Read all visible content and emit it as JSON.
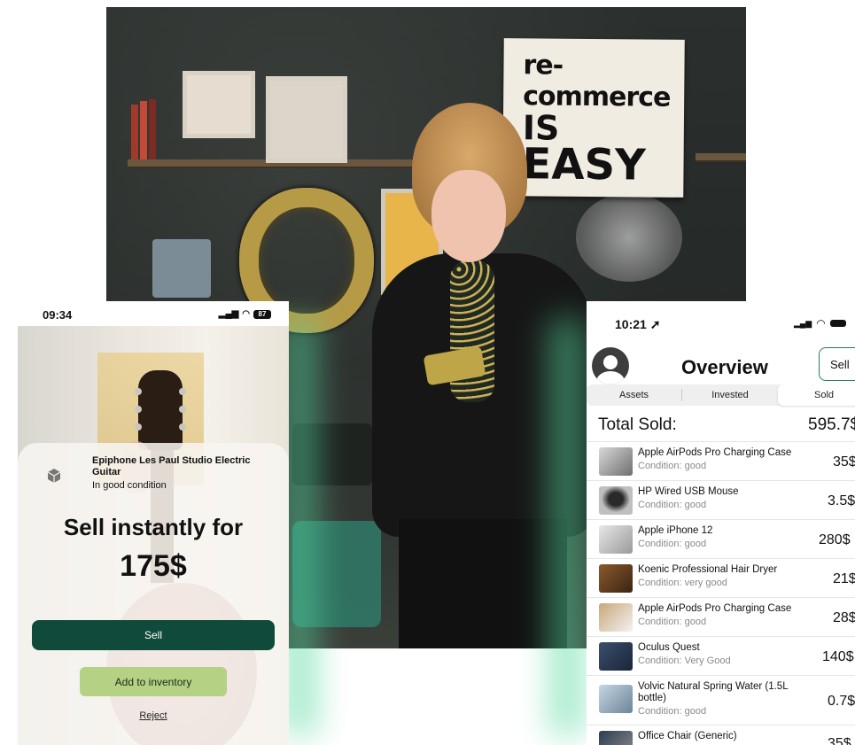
{
  "photo": {
    "sign_lines": [
      "re-commerce",
      "IS",
      "EASY"
    ]
  },
  "left_phone": {
    "status_time": "09:34",
    "battery": "87",
    "product_name": "Epiphone Les Paul Studio Electric Guitar",
    "product_condition": "In good condition",
    "headline": "Sell instantly for",
    "price": "175$",
    "sell_label": "Sell",
    "add_label": "Add to inventory",
    "reject_label": "Reject",
    "colors": {
      "sell_bg": "#0f4a3a",
      "add_bg": "#b5d184"
    }
  },
  "right_phone": {
    "status_time": "10:21",
    "title": "Overview",
    "sell_button": "Sell",
    "tabs": [
      "Assets",
      "Invested",
      "Sold"
    ],
    "active_tab": "Sold",
    "total_label": "Total Sold:",
    "total_value": "595.7$",
    "items": [
      {
        "name": "Apple AirPods Pro Charging Case",
        "condition": "Condition: good",
        "price": "35$"
      },
      {
        "name": "HP Wired USB Mouse",
        "condition": "Condition: good",
        "price": "3.5$"
      },
      {
        "name": "Apple iPhone 12",
        "condition": "Condition: good",
        "price": "280$"
      },
      {
        "name": "Koenic Professional Hair Dryer",
        "condition": "Condition: very good",
        "price": "21$"
      },
      {
        "name": "Apple AirPods Pro Charging Case",
        "condition": "Condition: good",
        "price": "28$"
      },
      {
        "name": "Oculus Quest",
        "condition": "Condition: Very Good",
        "price": "140$"
      },
      {
        "name": "Volvic Natural Spring Water (1.5L bottle)",
        "condition": "Condition: good",
        "price": "0.7$"
      },
      {
        "name": "Office Chair (Generic)",
        "condition": "",
        "price": "35$"
      }
    ],
    "accent_color": "#2a7a60"
  }
}
